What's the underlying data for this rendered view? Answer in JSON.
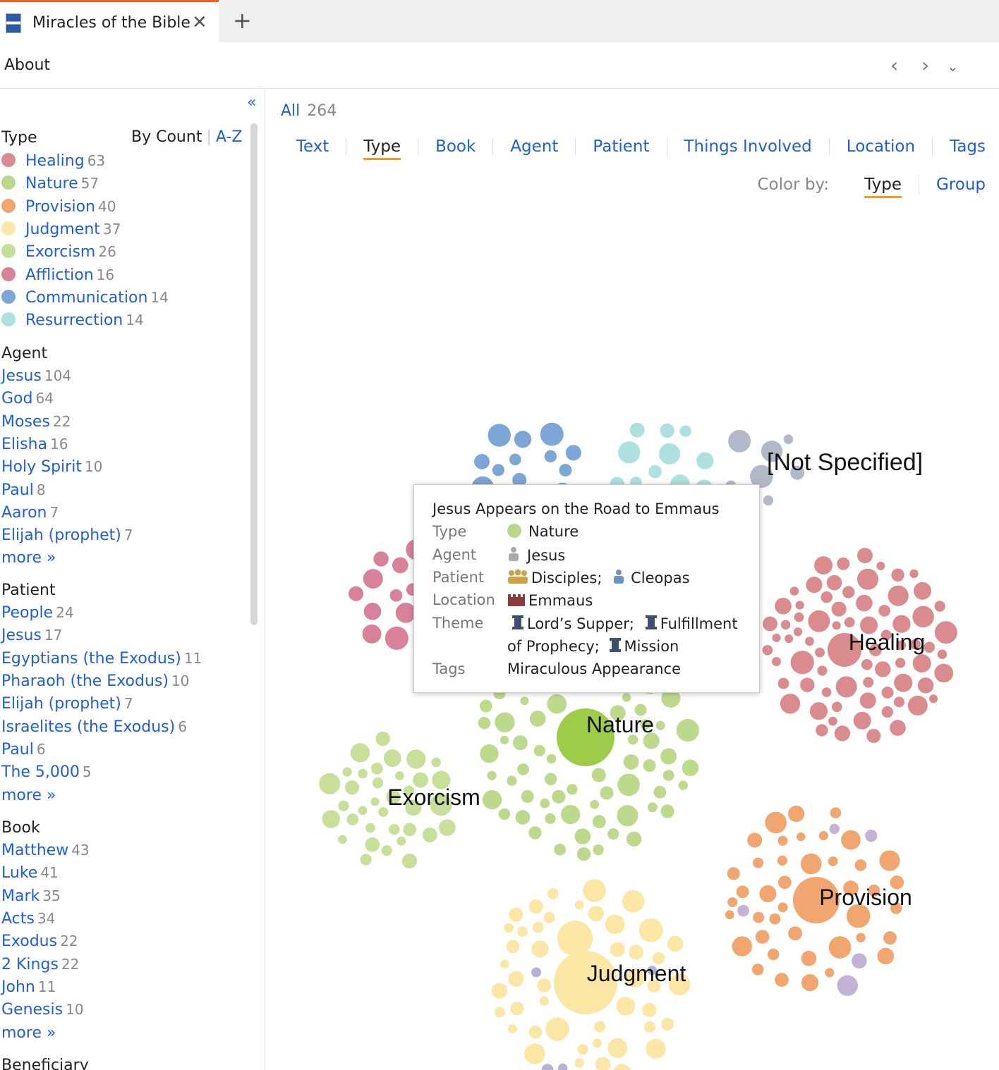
{
  "tab": {
    "title": "Miracles of the Bible",
    "close": "✕",
    "add": "+"
  },
  "toolbar": {
    "about": "About",
    "back": "‹",
    "forward": "›",
    "menu": "⌄"
  },
  "sidebar": {
    "collapse": "«",
    "type_title": "Type",
    "sort_by_count": "By Count",
    "sort_az": "A-Z",
    "types": [
      {
        "label": "Healing",
        "count": "63",
        "color": "#d98b8e"
      },
      {
        "label": "Nature",
        "count": "57",
        "color": "#b9d98a"
      },
      {
        "label": "Provision",
        "count": "40",
        "color": "#f0a66e"
      },
      {
        "label": "Judgment",
        "count": "37",
        "color": "#fbe6a6"
      },
      {
        "label": "Exorcism",
        "count": "26",
        "color": "#c6df98"
      },
      {
        "label": "Affliction",
        "count": "16",
        "color": "#d9809a"
      },
      {
        "label": "Communication",
        "count": "14",
        "color": "#7ba6d6"
      },
      {
        "label": "Resurrection",
        "count": "14",
        "color": "#afe0e0"
      }
    ],
    "agent_title": "Agent",
    "agents": [
      {
        "label": "Jesus",
        "count": "104"
      },
      {
        "label": "God",
        "count": "64"
      },
      {
        "label": "Moses",
        "count": "22"
      },
      {
        "label": "Elisha",
        "count": "16"
      },
      {
        "label": "Holy Spirit",
        "count": "10"
      },
      {
        "label": "Paul",
        "count": "8"
      },
      {
        "label": "Aaron",
        "count": "7"
      },
      {
        "label": "Elijah (prophet)",
        "count": "7"
      }
    ],
    "agent_more": "more »",
    "patient_title": "Patient",
    "patients": [
      {
        "label": "People",
        "count": "24"
      },
      {
        "label": "Jesus",
        "count": "17"
      },
      {
        "label": "Egyptians (the Exodus)",
        "count": "11"
      },
      {
        "label": "Pharaoh (the Exodus)",
        "count": "10"
      },
      {
        "label": "Elijah (prophet)",
        "count": "7"
      },
      {
        "label": "Israelites (the Exodus)",
        "count": "6"
      },
      {
        "label": "Paul",
        "count": "6"
      },
      {
        "label": "The 5,000",
        "count": "5"
      }
    ],
    "patient_more": "more »",
    "book_title": "Book",
    "books": [
      {
        "label": "Matthew",
        "count": "43"
      },
      {
        "label": "Luke",
        "count": "41"
      },
      {
        "label": "Mark",
        "count": "35"
      },
      {
        "label": "Acts",
        "count": "34"
      },
      {
        "label": "Exodus",
        "count": "22"
      },
      {
        "label": "2 Kings",
        "count": "22"
      },
      {
        "label": "John",
        "count": "11"
      },
      {
        "label": "Genesis",
        "count": "10"
      }
    ],
    "book_more": "more »",
    "beneficiary_title": "Beneficiary"
  },
  "main": {
    "all_label": "All",
    "all_count": "264",
    "tabs": [
      "Text",
      "Type",
      "Book",
      "Agent",
      "Patient",
      "Things Involved",
      "Location",
      "Tags"
    ],
    "active_tab": "Type",
    "color_by_label": "Color by:",
    "color_by_options": [
      "Type",
      "Group"
    ],
    "color_by_active": "Type"
  },
  "clusters": [
    {
      "label": "[Not Specified]"
    },
    {
      "label": "Healing"
    },
    {
      "label": "Nature"
    },
    {
      "label": "Exorcism"
    },
    {
      "label": "Provision"
    },
    {
      "label": "Judgment"
    }
  ],
  "tooltip": {
    "title": "Jesus Appears on the Road to Emmaus",
    "type_key": "Type",
    "type_val": "Nature",
    "agent_key": "Agent",
    "agent_val": "Jesus",
    "patient_key": "Patient",
    "patient_val1": "Disciples;",
    "patient_val2": "Cleopas",
    "location_key": "Location",
    "location_val": "Emmaus",
    "theme_key": "Theme",
    "theme_val1": "Lord’s Supper;",
    "theme_val2": "Fulfillment",
    "theme_val3": "of Prophecy;",
    "theme_val4": "Mission",
    "tags_key": "Tags",
    "tags_val": "Miraculous Appearance"
  }
}
